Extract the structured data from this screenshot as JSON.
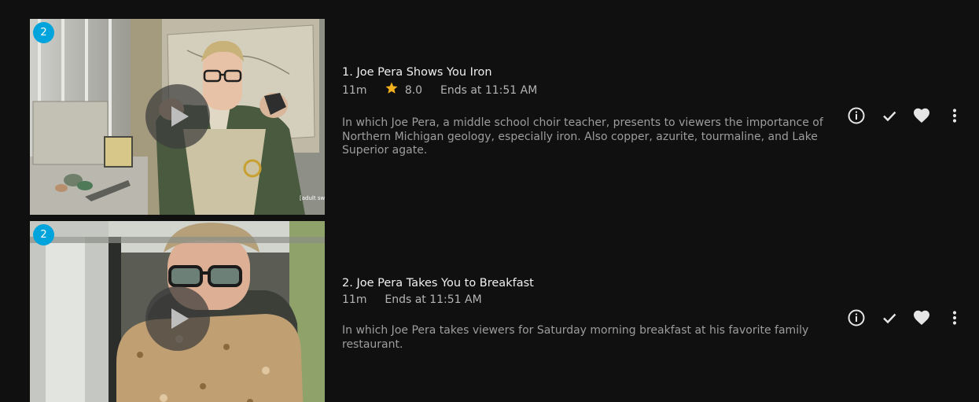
{
  "episodes": [
    {
      "badge": "2",
      "title": "1. Joe Pera Shows You Iron",
      "runtime": "11m",
      "rating": "8.0",
      "ends_at": "Ends at 11:51 AM",
      "description": "In which Joe Pera, a middle school choir teacher, presents to viewers the importance of Northern Michigan geology, especially iron. Also copper, azurite, tourmaline, and Lake Superior agate.",
      "watermark": "[adult swim]"
    },
    {
      "badge": "2",
      "title": "2. Joe Pera Takes You to Breakfast",
      "runtime": "11m",
      "ends_at": "Ends at 11:51 AM",
      "description": "In which Joe Pera takes viewers for Saturday morning breakfast at his favorite family restaurant."
    }
  ],
  "icons": {
    "play": "play-icon",
    "info": "info-icon",
    "played": "check-icon",
    "favorite": "heart-icon",
    "more": "more-vertical-icon",
    "star": "star-icon"
  },
  "colors": {
    "background": "#101010",
    "badge": "#00a4dc",
    "star": "#f2b01e",
    "title": "#f0f0f0",
    "meta": "#b4b4b4",
    "description": "#9d9d9d"
  }
}
